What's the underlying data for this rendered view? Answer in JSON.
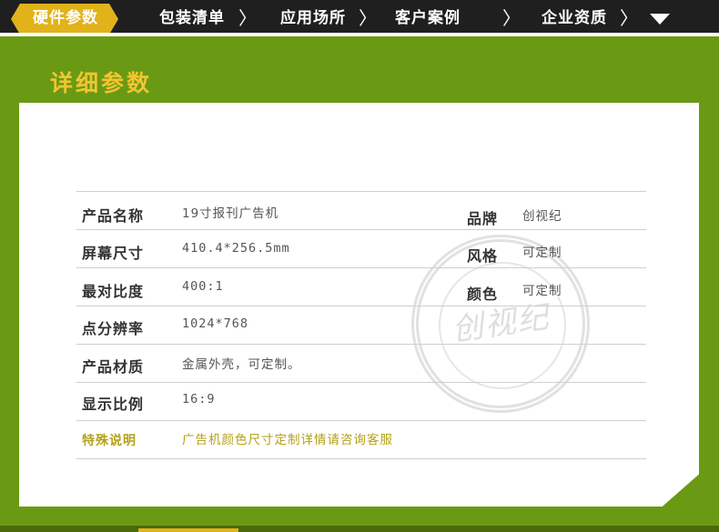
{
  "nav": {
    "tabs": [
      {
        "label": "硬件参数",
        "active": true
      },
      {
        "label": "包装清单",
        "active": false
      },
      {
        "label": "应用场所",
        "active": false
      },
      {
        "label": "客户案例",
        "active": false
      },
      {
        "label": "企业资质",
        "active": false
      }
    ],
    "separator": "〉",
    "more_icon": "triangle-down-icon"
  },
  "section": {
    "title": "详细参数"
  },
  "specs": {
    "left": [
      {
        "label": "产品名称",
        "value": "19寸报刊广告机"
      },
      {
        "label": "屏幕尺寸",
        "value": "410.4*256.5mm"
      },
      {
        "label": "最对比度",
        "value": "400:1"
      },
      {
        "label": "点分辨率",
        "value": "1024*768"
      },
      {
        "label": "产品材质",
        "value": "金属外壳，可定制。"
      },
      {
        "label": "显示比例",
        "value": "16:9"
      },
      {
        "label": "特殊说明",
        "value": "广告机颜色尺寸定制详情请咨询客服"
      }
    ],
    "right": [
      {
        "label": "品牌",
        "value": "创视纪"
      },
      {
        "label": "风格",
        "value": "可定制"
      },
      {
        "label": "颜色",
        "value": "可定制"
      }
    ]
  },
  "seal": {
    "text": "创视纪"
  },
  "colors": {
    "green": "#6a9a14",
    "gold": "#e1b21a",
    "title": "#f2c531",
    "note": "#b4a21a",
    "nav_bg": "#1f1f1f"
  }
}
